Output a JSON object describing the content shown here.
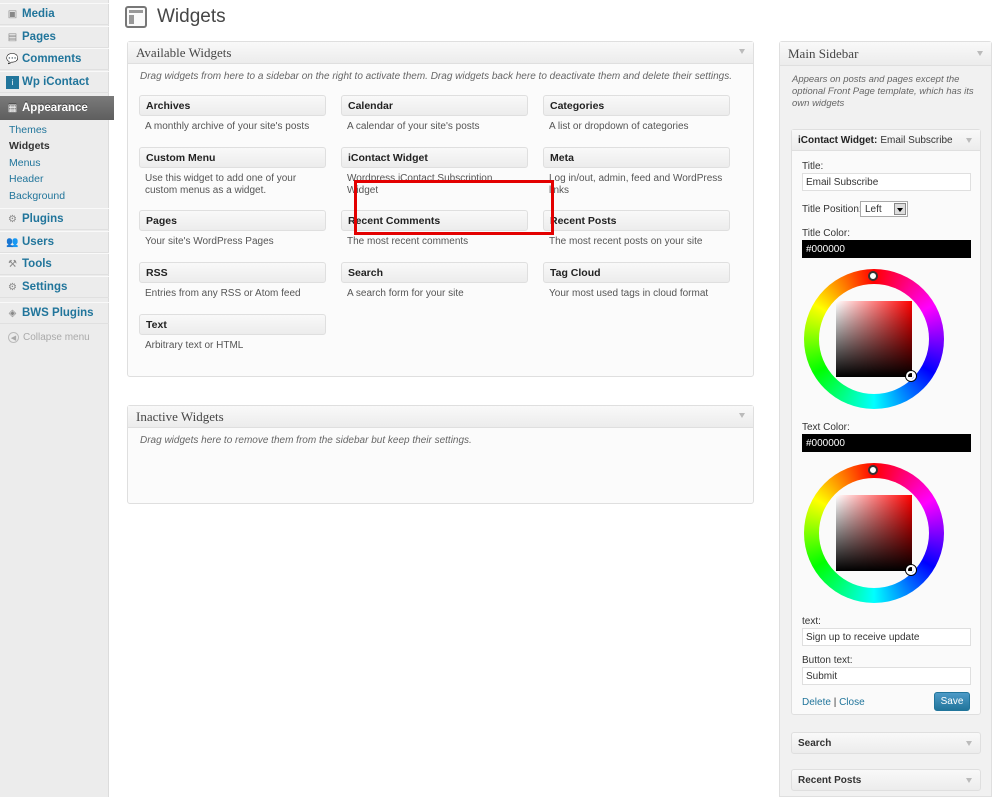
{
  "menu": {
    "media": "Media",
    "pages": "Pages",
    "comments": "Comments",
    "wp_icontact": "Wp iContact",
    "appearance": "Appearance",
    "submenu": [
      "Themes",
      "Widgets",
      "Menus",
      "Header",
      "Background"
    ],
    "plugins": "Plugins",
    "users": "Users",
    "tools": "Tools",
    "settings": "Settings",
    "bws_plugins": "BWS Plugins",
    "collapse": "Collapse menu"
  },
  "page_title": "Widgets",
  "available": {
    "title": "Available Widgets",
    "description": "Drag widgets from here to a sidebar on the right to activate them. Drag widgets back here to deactivate them and delete their settings.",
    "widgets": [
      {
        "title": "Archives",
        "desc": "A monthly archive of your site's posts"
      },
      {
        "title": "Calendar",
        "desc": "A calendar of your site's posts"
      },
      {
        "title": "Categories",
        "desc": "A list or dropdown of categories"
      },
      {
        "title": "Custom Menu",
        "desc": "Use this widget to add one of your custom menus as a widget."
      },
      {
        "title": "iContact Widget",
        "desc": "Wordpress iContact Subscription Widget"
      },
      {
        "title": "Meta",
        "desc": "Log in/out, admin, feed and WordPress links"
      },
      {
        "title": "Pages",
        "desc": "Your site's WordPress Pages"
      },
      {
        "title": "Recent Comments",
        "desc": "The most recent comments"
      },
      {
        "title": "Recent Posts",
        "desc": "The most recent posts on your site"
      },
      {
        "title": "RSS",
        "desc": "Entries from any RSS or Atom feed"
      },
      {
        "title": "Search",
        "desc": "A search form for your site"
      },
      {
        "title": "Tag Cloud",
        "desc": "Your most used tags in cloud format"
      },
      {
        "title": "Text",
        "desc": "Arbitrary text or HTML"
      }
    ]
  },
  "inactive": {
    "title": "Inactive Widgets",
    "description": "Drag widgets here to remove them from the sidebar but keep their settings."
  },
  "sidebar": {
    "title": "Main Sidebar",
    "description": "Appears on posts and pages except the optional Front Page template, which has its own widgets",
    "icontact": {
      "header": "iContact Widget:",
      "header_instance": "Email Subscribe",
      "title_label": "Title:",
      "title_value": "Email Subscribe",
      "title_position_label": "Title Position:",
      "title_position_value": "Left",
      "title_color_label": "Title Color:",
      "title_color_value": "#000000",
      "text_color_label": "Text Color:",
      "text_color_value": "#000000",
      "text_label": "text:",
      "text_value": "Sign up to receive update",
      "button_text_label": "Button text:",
      "button_text_value": "Submit",
      "delete": "Delete",
      "separator": "|",
      "close": "Close",
      "save": "Save"
    },
    "other_widgets": [
      "Search",
      "Recent Posts"
    ]
  },
  "colors": {
    "link": "#21759b",
    "highlight": "#e30000",
    "menu_current": "#5e5e5e"
  }
}
